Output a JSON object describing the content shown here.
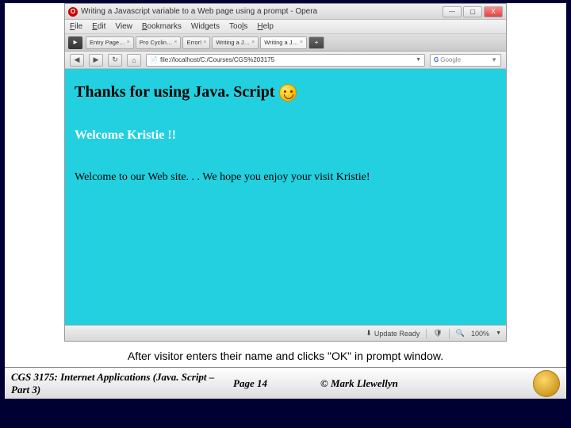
{
  "window": {
    "title": "Writing a Javascript variable to a Web page using a prompt - Opera",
    "controls": {
      "min": "—",
      "max": "▢",
      "close": "X"
    }
  },
  "menu": {
    "file": "File",
    "edit": "Edit",
    "view": "View",
    "bookmarks": "Bookmarks",
    "widgets": "Widgets",
    "tools": "Tools",
    "help": "Help"
  },
  "tabs": {
    "items": [
      {
        "label": "Entry Page…"
      },
      {
        "label": "Pro Cyclin…"
      },
      {
        "label": "Error!"
      },
      {
        "label": "Writing a J…"
      },
      {
        "label": "Writing a J…"
      }
    ],
    "plus": "+"
  },
  "address": {
    "url": "file://localhost/C:/Courses/CGS%203175",
    "search_placeholder": "Google"
  },
  "page": {
    "heading": "Thanks for using Java. Script",
    "welcome_name": "Welcome Kristie !!",
    "welcome_msg": "Welcome to our Web site. . . We hope you enjoy your visit Kristie!"
  },
  "status": {
    "update": "Update Ready",
    "zoom": "100%"
  },
  "caption": "After visitor enters their name and clicks \"OK\" in prompt window.",
  "footer": {
    "course": "CGS 3175: Internet Applications (Java. Script – Part 3)",
    "page": "Page 14",
    "copyright": "© Mark Llewellyn"
  }
}
